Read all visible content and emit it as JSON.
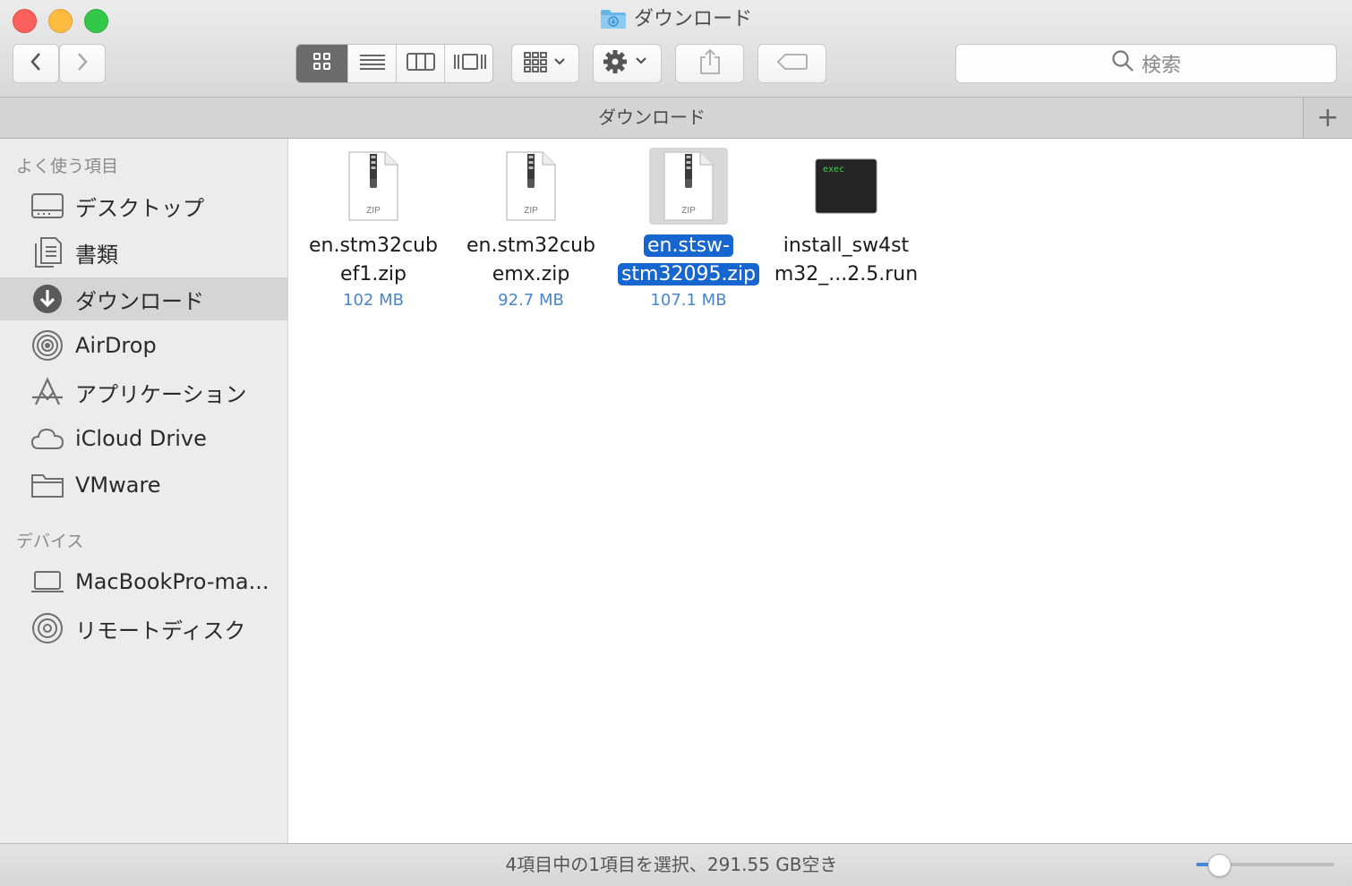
{
  "window": {
    "title": "ダウンロード"
  },
  "toolbar": {
    "back": "back-icon",
    "forward": "forward-icon",
    "views": [
      "icon-view-icon",
      "list-view-icon",
      "column-view-icon",
      "coverflow-view-icon"
    ],
    "active_view": 0,
    "search_placeholder": "検索"
  },
  "tabbar": {
    "label": "ダウンロード",
    "add": "+"
  },
  "sidebar": {
    "sections": [
      {
        "header": "よく使う項目",
        "items": [
          {
            "label": "デスクトップ",
            "icon": "desktop-icon"
          },
          {
            "label": "書類",
            "icon": "documents-icon"
          },
          {
            "label": "ダウンロード",
            "icon": "downloads-icon",
            "selected": true
          },
          {
            "label": "AirDrop",
            "icon": "airdrop-icon"
          },
          {
            "label": "アプリケーション",
            "icon": "applications-icon"
          },
          {
            "label": "iCloud Drive",
            "icon": "cloud-icon"
          },
          {
            "label": "VMware",
            "icon": "folder-icon"
          }
        ]
      },
      {
        "header": "デバイス",
        "items": [
          {
            "label": "MacBookPro-ma...",
            "icon": "laptop-icon"
          },
          {
            "label": "リモートディスク",
            "icon": "disc-icon"
          }
        ]
      }
    ]
  },
  "files": [
    {
      "line1": "en.stm32cub",
      "line2": "ef1.zip",
      "size": "102 MB",
      "type": "zip",
      "badge": "ZIP"
    },
    {
      "line1": "en.stm32cub",
      "line2": "emx.zip",
      "size": "92.7 MB",
      "type": "zip",
      "badge": "ZIP"
    },
    {
      "line1": "en.stsw-",
      "line2": "stm32095.zip",
      "size": "107.1 MB",
      "type": "zip",
      "badge": "ZIP",
      "selected": true
    },
    {
      "line1": "install_sw4st",
      "line2": "m32_...2.5.run",
      "size": "",
      "type": "exec",
      "badge": "exec"
    }
  ],
  "status": {
    "text": "4項目中の1項目を選択、291.55 GB空き",
    "zoom": 0.16
  }
}
